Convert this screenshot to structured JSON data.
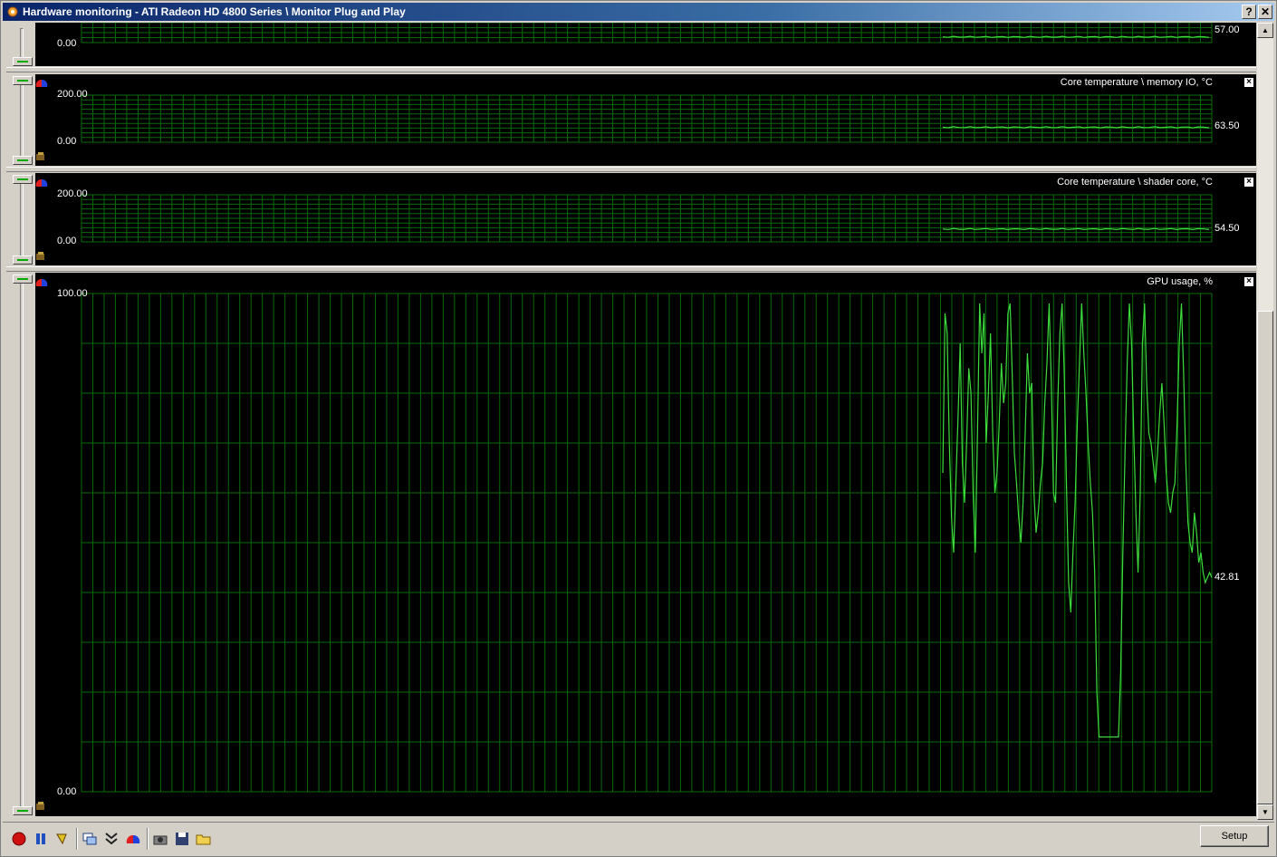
{
  "window": {
    "title": "Hardware monitoring - ATI Radeon HD 4800 Series  \\ Monitor Plug and Play",
    "help_label": "?",
    "close_label": "✕"
  },
  "panels": [
    {
      "id": "panel-top",
      "title": "",
      "y_max": "",
      "y_min": "0.00",
      "current": "57.00",
      "series_level": 0.285
    },
    {
      "id": "panel-memory",
      "title": "Core temperature \\ memory IO, °C",
      "y_max": "200.00",
      "y_min": "0.00",
      "current": "63.50",
      "series_level": 0.3175
    },
    {
      "id": "panel-shader",
      "title": "Core temperature \\ shader core, °C",
      "y_max": "200.00",
      "y_min": "0.00",
      "current": "54.50",
      "series_level": 0.2725
    },
    {
      "id": "panel-gpu",
      "title": "GPU usage, %",
      "y_max": "100.00",
      "y_min": "0.00",
      "current": "42.81"
    }
  ],
  "chart_data": {
    "type": "line",
    "title": "GPU usage, %",
    "ylim": [
      0,
      100
    ],
    "series": [
      {
        "values": [
          64,
          96,
          92,
          70,
          55,
          48,
          62,
          75,
          90,
          66,
          58,
          70,
          85,
          80,
          60,
          48,
          72,
          98,
          88,
          96,
          70,
          80,
          92,
          72,
          60,
          64,
          74,
          86,
          78,
          82,
          96,
          98,
          84,
          68,
          62,
          55,
          50,
          58,
          72,
          88,
          80,
          82,
          60,
          52,
          56,
          62,
          66,
          78,
          86,
          98,
          82,
          60,
          58,
          78,
          92,
          98,
          84,
          62,
          42,
          36,
          48,
          58,
          74,
          86,
          98,
          88,
          80,
          70,
          62,
          56,
          44,
          20,
          11,
          11,
          11,
          11,
          11,
          11,
          11,
          11,
          11,
          11,
          24,
          48,
          68,
          86,
          98,
          90,
          72,
          56,
          44,
          60,
          90,
          98,
          82,
          72,
          70,
          66,
          62,
          68,
          76,
          82,
          74,
          64,
          58,
          56,
          60,
          62,
          74,
          90,
          98,
          84,
          66,
          54,
          50,
          48,
          56,
          52,
          46,
          48,
          44,
          42,
          43,
          44,
          43
        ],
        "current": 42.81
      }
    ],
    "temperature_series": [
      {
        "name": "Core temperature \\ memory IO, °C",
        "ylim": [
          0,
          200
        ],
        "current": 63.5
      },
      {
        "name": "Core temperature \\ shader core, °C",
        "ylim": [
          0,
          200
        ],
        "current": 54.5
      },
      {
        "name": "",
        "current": 57.0
      }
    ]
  },
  "toolbar": {
    "icons": [
      "record-icon",
      "pause-icon",
      "highlight-icon",
      "windows-icon",
      "collapse-icon",
      "gauge-icon",
      "screenshot-icon",
      "save-icon",
      "open-folder-icon"
    ],
    "setup_label": "Setup"
  },
  "colors": {
    "grid": "#0a6b0a",
    "series": "#3cdc3c",
    "background": "#000000"
  }
}
